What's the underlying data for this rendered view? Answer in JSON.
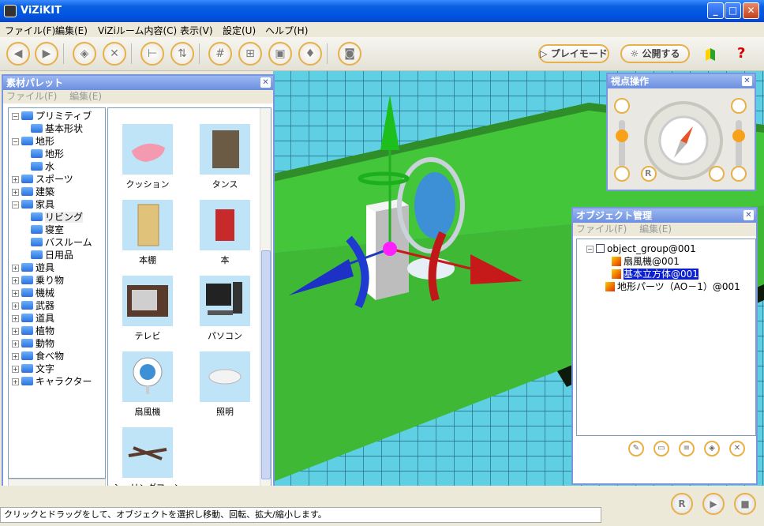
{
  "window": {
    "title": "ViZiKIT"
  },
  "menu": [
    "ファイル(F)",
    "編集(E)",
    "ViZiルーム内容(C)",
    "表示(V)",
    "設定(U)",
    "ヘルプ(H)"
  ],
  "toolbar": {
    "play_mode": "プレイモード",
    "publish": "公開する",
    "help": "?"
  },
  "palette": {
    "title": "素材パレット",
    "menu": [
      "ファイル(F)",
      "編集(E)"
    ],
    "tree": [
      {
        "label": "プリミティブ",
        "expanded": true
      },
      {
        "label": "基本形状",
        "child": true
      },
      {
        "label": "地形",
        "expanded": true
      },
      {
        "label": "地形",
        "child": true
      },
      {
        "label": "水",
        "child": true
      },
      {
        "label": "スポーツ"
      },
      {
        "label": "建築"
      },
      {
        "label": "家具",
        "expanded": true
      },
      {
        "label": "リビング",
        "child": true,
        "selected": true
      },
      {
        "label": "寝室",
        "child": true
      },
      {
        "label": "バスルーム",
        "child": true
      },
      {
        "label": "日用品",
        "child": true
      },
      {
        "label": "遊具"
      },
      {
        "label": "乗り物"
      },
      {
        "label": "機械"
      },
      {
        "label": "武器"
      },
      {
        "label": "道具"
      },
      {
        "label": "植物"
      },
      {
        "label": "動物"
      },
      {
        "label": "食べ物"
      },
      {
        "label": "文字"
      },
      {
        "label": "キャラクター"
      }
    ],
    "items": [
      {
        "label": "クッション"
      },
      {
        "label": "タンス"
      },
      {
        "label": "本棚"
      },
      {
        "label": "本"
      },
      {
        "label": "テレビ"
      },
      {
        "label": "パソコン"
      },
      {
        "label": "扇風機"
      },
      {
        "label": "照明"
      },
      {
        "label": "シーリングファン"
      }
    ]
  },
  "viewpoint": {
    "title": "視点操作",
    "reset": "R"
  },
  "objects": {
    "title": "オブジェクト管理",
    "menu": [
      "ファイル(F)",
      "編集(E)"
    ],
    "tree": [
      {
        "label": "object_group@001"
      },
      {
        "label": "扇風機@001"
      },
      {
        "label": "基本立方体@001",
        "selected": true
      },
      {
        "label": "地形パーツ（AO－1）@001"
      }
    ]
  },
  "status": {
    "text": "クリックとドラッグをして、オブジェクトを選択し移動、回転、拡大/縮小します。"
  }
}
